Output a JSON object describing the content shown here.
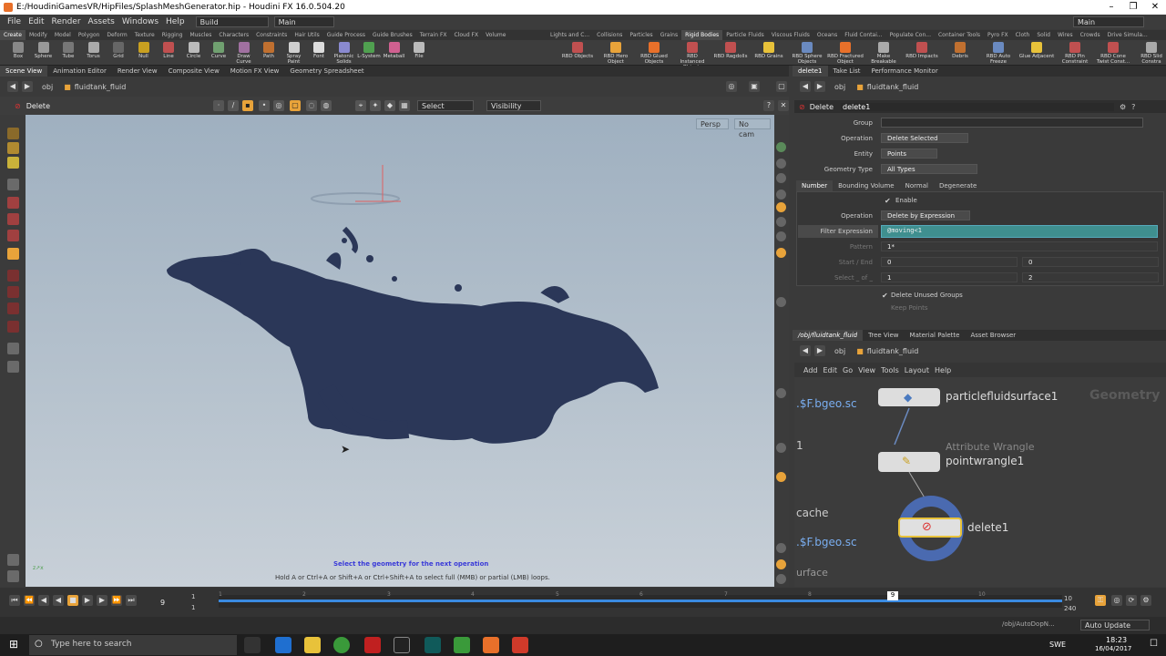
{
  "window": {
    "title": "E:/HoudiniGamesVR/HipFiles/SplashMeshGenerator.hip - Houdini FX 16.0.504.20"
  },
  "menu": {
    "items": [
      "File",
      "Edit",
      "Render",
      "Assets",
      "Windows",
      "Help"
    ],
    "build": "Build",
    "desktop": "Main",
    "desktop_right": "Main"
  },
  "shelf_tabs_left": [
    "Create",
    "Modify",
    "Model",
    "Polygon",
    "Deform",
    "Texture",
    "Rigging",
    "Muscles",
    "Characters",
    "Constraints",
    "Hair Utils",
    "Guide Process",
    "Guide Brushes",
    "Terrain FX",
    "Cloud FX",
    "Volume"
  ],
  "shelf_tabs_right": [
    "Lights and C...",
    "Collisions",
    "Particles",
    "Grains",
    "Rigid Bodies",
    "Particle Fluids",
    "Viscous Fluids",
    "Oceans",
    "Fluid Contai...",
    "Populate Con...",
    "Container Tools",
    "Pyro FX",
    "Cloth",
    "Solid",
    "Wires",
    "Crowds",
    "Drive Simula..."
  ],
  "tools_left": [
    "Box",
    "Sphere",
    "Tube",
    "Torus",
    "Grid",
    "Null",
    "Line",
    "Circle",
    "Curve",
    "Draw Curve",
    "Path",
    "Spray Paint",
    "Font",
    "Platonic Solids",
    "L-System",
    "Metaball",
    "File"
  ],
  "tools_right": [
    "RBD Objects",
    "RBD Hero Object",
    "RBD Glued Objects",
    "RBD Instanced Objects",
    "RBD Ragdolls",
    "RBD Grains",
    "RBD Sphere Objects",
    "RBD Fractured Object",
    "Make Breakable",
    "RBD Impacts",
    "Debris",
    "RBD Auto Freeze",
    "Glue Adjacent",
    "RBD Pin Constraint",
    "RBD Cone Twist Const...",
    "RBD Slid Constra"
  ],
  "pane_tabs_left": [
    "Scene View",
    "Animation Editor",
    "Render View",
    "Composite View",
    "Motion FX View",
    "Geometry Spreadsheet"
  ],
  "pane_tabs_right": [
    "delete1",
    "Take List",
    "Performance Monitor"
  ],
  "path": {
    "root": "obj",
    "node": "fluidtank_fluid"
  },
  "viewport": {
    "operation": "Delete",
    "select_mode": "Select",
    "visibility": "Visibility",
    "camera": "Persp",
    "cam": "No cam",
    "status": "Select the geometry for the next operation",
    "hint": "Hold A or Ctrl+A or Shift+A or Ctrl+Shift+A to select full (MMB) or partial (LMB) loops."
  },
  "params": {
    "type": "Delete",
    "node": "delete1",
    "group_label": "Group",
    "operation_label": "Operation",
    "operation_value": "Delete Selected",
    "entity_label": "Entity",
    "entity_value": "Points",
    "geotype_label": "Geometry Type",
    "geotype_value": "All Types",
    "tabs": [
      "Number",
      "Bounding Volume",
      "Normal",
      "Degenerate"
    ],
    "enable": "Enable",
    "op2_label": "Operation",
    "op2_value": "Delete by Expression",
    "filter_label": "Filter Expression",
    "filter_value": "@moving<1",
    "pattern_label": "Pattern",
    "pattern_value": "1*",
    "startend_label": "Start / End",
    "start": "0",
    "end": "0",
    "select_label": "Select _ of _",
    "sel1": "1",
    "sel2": "2",
    "unused": "Delete Unused Groups",
    "keep": "Keep Points"
  },
  "net_tabs": [
    "/obj/fluidtank_fluid",
    "Tree View",
    "Material Palette",
    "Asset Browser"
  ],
  "net_menu": [
    "Add",
    "Edit",
    "Go",
    "View",
    "Tools",
    "Layout",
    "Help"
  ],
  "net": {
    "watermark": "Geometry",
    "n1": "particlefluidsurface1",
    "n2_type": "Attribute Wrangle",
    "n2": "pointwrangle1",
    "n3": "delete1",
    "left1": ".$F.bgeo.sc",
    "left2": "1",
    "left3": "cache",
    "left4": ".$F.bgeo.sc",
    "left5": "urface"
  },
  "timeline": {
    "frame": "9",
    "start": "1",
    "start2": "1",
    "end": "10",
    "end2": "240",
    "ticks": [
      "1",
      "2",
      "3",
      "4",
      "5",
      "6",
      "7",
      "8",
      "9",
      "10"
    ],
    "cursor": "9",
    "path": "/obj/AutoDopN...",
    "update": "Auto Update"
  },
  "taskbar": {
    "search": "Type here to search",
    "lang": "SWE",
    "time": "18:23",
    "date": "16/04/2017"
  }
}
